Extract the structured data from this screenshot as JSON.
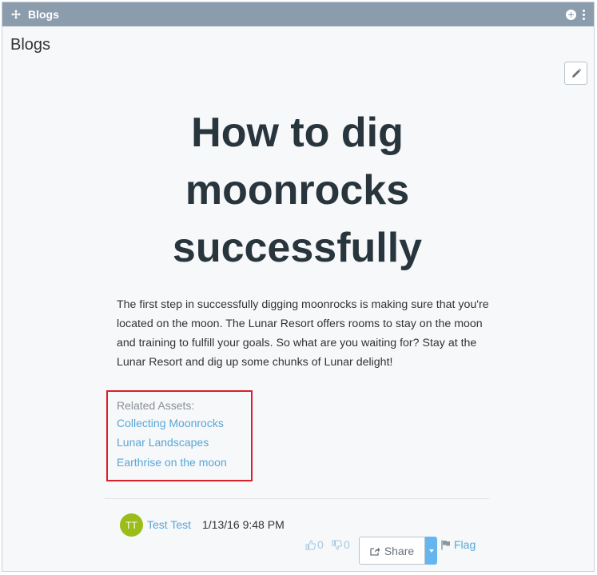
{
  "portlet": {
    "titlebar_title": "Blogs",
    "heading": "Blogs"
  },
  "post": {
    "title_lines": [
      "How to dig",
      "moonrocks",
      "successfully"
    ],
    "body": "The first step in successfully digging moonrocks is making sure that you're located on the moon. The Lunar Resort offers rooms to stay on the moon and training to fulfill your goals. So what are you waiting for? Stay at the Lunar Resort and dig up some chunks of Lunar delight!"
  },
  "related": {
    "label": "Related Assets:",
    "links": [
      "Collecting Moonrocks",
      "Lunar Landscapes",
      "Earthrise on the moon"
    ]
  },
  "footer": {
    "avatar_initials": "TT",
    "author": "Test Test",
    "timestamp": "1/13/16 9:48 PM",
    "thumbs_up_count": "0",
    "thumbs_down_count": "0",
    "share_label": "Share",
    "flag_label": "Flag"
  },
  "colors": {
    "titlebar": "#8b9cad",
    "link": "#5aa6d6",
    "highlight_border": "#d9202c",
    "avatar": "#9bbd19",
    "share_caret": "#65b6ef"
  },
  "icons": [
    "move-icon",
    "add-icon",
    "kebab-icon",
    "pencil-icon",
    "thumbs-up-icon",
    "thumbs-down-icon",
    "share-icon",
    "caret-down-icon",
    "flag-icon"
  ]
}
